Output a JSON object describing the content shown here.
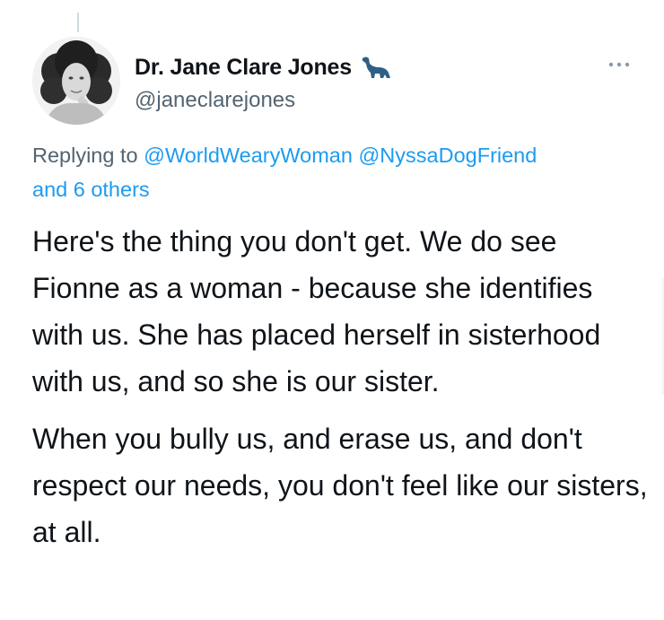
{
  "tweet": {
    "author": {
      "display_name": "Dr. Jane Clare Jones",
      "handle": "@janeclarejones",
      "name_emoji_icon": "dinosaur-icon"
    },
    "more_icon": "more-options-icon",
    "reply_context": {
      "prefix": "Replying to",
      "mention_1": "@WorldWearyWoman",
      "mention_2": "@NyssaDogFriend",
      "others": "and 6 others"
    },
    "paragraphs": [
      "Here's the thing you don't get. We do see Fionne as a woman - because she identifies with us. She has placed herself in sisterhood with us, and so she is our sister.",
      "When you bully us, and erase us, and don't respect our needs, you don't feel like our sisters, at all."
    ]
  },
  "colors": {
    "text_primary": "#0f1419",
    "text_secondary": "#536471",
    "accent_blue": "#1d9bf0",
    "dinosaur_icon": "#2f5f86"
  }
}
